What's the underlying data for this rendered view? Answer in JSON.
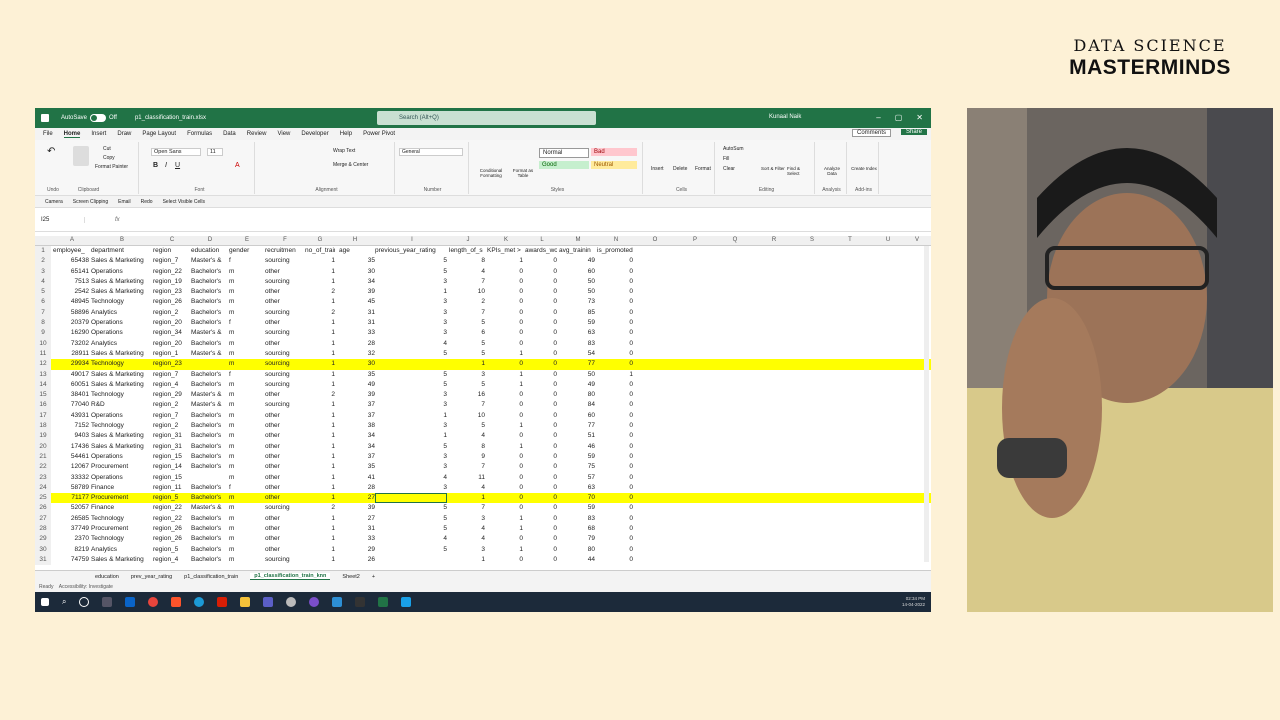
{
  "brand": {
    "line1": "DATA SCIENCE",
    "line2": "MASTERMINDS"
  },
  "titlebar": {
    "autosave_label": "AutoSave",
    "autosave_state": "Off",
    "file_name": "p1_classification_train.xlsx",
    "search_placeholder": "Search (Alt+Q)",
    "user": "Kunaal Naik"
  },
  "ribbon_tabs": [
    "File",
    "Home",
    "Insert",
    "Draw",
    "Page Layout",
    "Formulas",
    "Data",
    "Review",
    "View",
    "Developer",
    "Help",
    "Power Pivot"
  ],
  "comments_label": "Comments",
  "share_label": "Share",
  "ribbon": {
    "clipboard": {
      "cut": "Cut",
      "copy": "Copy",
      "format_painter": "Format Painter",
      "label": "Clipboard",
      "paste": "Paste",
      "undo": "Undo"
    },
    "font": {
      "name": "Open Sans",
      "size": "11",
      "label": "Font"
    },
    "alignment": {
      "wrap": "Wrap Text",
      "merge": "Merge & Center",
      "label": "Alignment"
    },
    "number": {
      "format": "General",
      "label": "Number"
    },
    "styles": {
      "conditional": "Conditional Formatting",
      "format_table": "Format as Table",
      "normal": "Normal",
      "bad": "Bad",
      "good": "Good",
      "neutral": "Neutral",
      "label": "Styles"
    },
    "cells": {
      "insert": "Insert",
      "delete": "Delete",
      "format": "Format",
      "label": "Cells"
    },
    "editing": {
      "autosum": "AutoSum",
      "fill": "Fill",
      "clear": "Clear",
      "sort": "Sort & Filter",
      "find": "Find & Select",
      "label": "Editing"
    },
    "analysis": {
      "analyze": "Analyze Data",
      "label": "Analysis"
    },
    "addins": {
      "create": "Create Index",
      "label": "Add-ins"
    }
  },
  "qat": [
    "Camera",
    "Screen Clipping",
    "Email",
    "Redo",
    "Select Visible Cells"
  ],
  "name_box": "I25",
  "columns": [
    "A",
    "B",
    "C",
    "D",
    "E",
    "F",
    "G",
    "H",
    "I",
    "J",
    "K",
    "L",
    "M",
    "N",
    "O",
    "P",
    "Q",
    "R",
    "S",
    "T",
    "U",
    "V"
  ],
  "header_row": {
    "rn": "1",
    "a": "employee_",
    "b": "department",
    "c": "region",
    "d": "education",
    "e": "gender",
    "f": "recruitmen",
    "g": "no_of_train",
    "h": "age",
    "i": "previous_year_rating",
    "j": "length_of_s",
    "k": "KPIs_met >",
    "l": "awards_wo",
    "m": "avg_trainin",
    "n": "is_promoted"
  },
  "rows": [
    {
      "rn": "2",
      "a": "65438",
      "b": "Sales & Marketing",
      "c": "region_7",
      "d": "Master's &",
      "e": "f",
      "f": "sourcing",
      "g": "1",
      "h": "35",
      "i": "5",
      "j": "8",
      "k": "1",
      "l": "0",
      "m": "49",
      "n": "0"
    },
    {
      "rn": "3",
      "a": "65141",
      "b": "Operations",
      "c": "region_22",
      "d": "Bachelor's",
      "e": "m",
      "f": "other",
      "g": "1",
      "h": "30",
      "i": "5",
      "j": "4",
      "k": "0",
      "l": "0",
      "m": "60",
      "n": "0"
    },
    {
      "rn": "4",
      "a": "7513",
      "b": "Sales & Marketing",
      "c": "region_19",
      "d": "Bachelor's",
      "e": "m",
      "f": "sourcing",
      "g": "1",
      "h": "34",
      "i": "3",
      "j": "7",
      "k": "0",
      "l": "0",
      "m": "50",
      "n": "0"
    },
    {
      "rn": "5",
      "a": "2542",
      "b": "Sales & Marketing",
      "c": "region_23",
      "d": "Bachelor's",
      "e": "m",
      "f": "other",
      "g": "2",
      "h": "39",
      "i": "1",
      "j": "10",
      "k": "0",
      "l": "0",
      "m": "50",
      "n": "0"
    },
    {
      "rn": "6",
      "a": "48945",
      "b": "Technology",
      "c": "region_26",
      "d": "Bachelor's",
      "e": "m",
      "f": "other",
      "g": "1",
      "h": "45",
      "i": "3",
      "j": "2",
      "k": "0",
      "l": "0",
      "m": "73",
      "n": "0"
    },
    {
      "rn": "7",
      "a": "58896",
      "b": "Analytics",
      "c": "region_2",
      "d": "Bachelor's",
      "e": "m",
      "f": "sourcing",
      "g": "2",
      "h": "31",
      "i": "3",
      "j": "7",
      "k": "0",
      "l": "0",
      "m": "85",
      "n": "0"
    },
    {
      "rn": "8",
      "a": "20379",
      "b": "Operations",
      "c": "region_20",
      "d": "Bachelor's",
      "e": "f",
      "f": "other",
      "g": "1",
      "h": "31",
      "i": "3",
      "j": "5",
      "k": "0",
      "l": "0",
      "m": "59",
      "n": "0"
    },
    {
      "rn": "9",
      "a": "16290",
      "b": "Operations",
      "c": "region_34",
      "d": "Master's &",
      "e": "m",
      "f": "sourcing",
      "g": "1",
      "h": "33",
      "i": "3",
      "j": "6",
      "k": "0",
      "l": "0",
      "m": "63",
      "n": "0"
    },
    {
      "rn": "10",
      "a": "73202",
      "b": "Analytics",
      "c": "region_20",
      "d": "Bachelor's",
      "e": "m",
      "f": "other",
      "g": "1",
      "h": "28",
      "i": "4",
      "j": "5",
      "k": "0",
      "l": "0",
      "m": "83",
      "n": "0"
    },
    {
      "rn": "11",
      "a": "28911",
      "b": "Sales & Marketing",
      "c": "region_1",
      "d": "Master's &",
      "e": "m",
      "f": "sourcing",
      "g": "1",
      "h": "32",
      "i": "5",
      "j": "5",
      "k": "1",
      "l": "0",
      "m": "54",
      "n": "0"
    },
    {
      "rn": "12",
      "a": "29934",
      "b": "Technology",
      "c": "region_23",
      "d": "",
      "e": "m",
      "f": "sourcing",
      "g": "1",
      "h": "30",
      "i": "",
      "j": "1",
      "k": "0",
      "l": "0",
      "m": "77",
      "n": "0",
      "hl": true
    },
    {
      "rn": "13",
      "a": "49017",
      "b": "Sales & Marketing",
      "c": "region_7",
      "d": "Bachelor's",
      "e": "f",
      "f": "sourcing",
      "g": "1",
      "h": "35",
      "i": "5",
      "j": "3",
      "k": "1",
      "l": "0",
      "m": "50",
      "n": "1"
    },
    {
      "rn": "14",
      "a": "60051",
      "b": "Sales & Marketing",
      "c": "region_4",
      "d": "Bachelor's",
      "e": "m",
      "f": "sourcing",
      "g": "1",
      "h": "49",
      "i": "5",
      "j": "5",
      "k": "1",
      "l": "0",
      "m": "49",
      "n": "0"
    },
    {
      "rn": "15",
      "a": "38401",
      "b": "Technology",
      "c": "region_29",
      "d": "Master's &",
      "e": "m",
      "f": "other",
      "g": "2",
      "h": "39",
      "i": "3",
      "j": "16",
      "k": "0",
      "l": "0",
      "m": "80",
      "n": "0"
    },
    {
      "rn": "16",
      "a": "77040",
      "b": "R&D",
      "c": "region_2",
      "d": "Master's &",
      "e": "m",
      "f": "sourcing",
      "g": "1",
      "h": "37",
      "i": "3",
      "j": "7",
      "k": "0",
      "l": "0",
      "m": "84",
      "n": "0"
    },
    {
      "rn": "17",
      "a": "43931",
      "b": "Operations",
      "c": "region_7",
      "d": "Bachelor's",
      "e": "m",
      "f": "other",
      "g": "1",
      "h": "37",
      "i": "1",
      "j": "10",
      "k": "0",
      "l": "0",
      "m": "60",
      "n": "0"
    },
    {
      "rn": "18",
      "a": "7152",
      "b": "Technology",
      "c": "region_2",
      "d": "Bachelor's",
      "e": "m",
      "f": "other",
      "g": "1",
      "h": "38",
      "i": "3",
      "j": "5",
      "k": "1",
      "l": "0",
      "m": "77",
      "n": "0"
    },
    {
      "rn": "19",
      "a": "9403",
      "b": "Sales & Marketing",
      "c": "region_31",
      "d": "Bachelor's",
      "e": "m",
      "f": "other",
      "g": "1",
      "h": "34",
      "i": "1",
      "j": "4",
      "k": "0",
      "l": "0",
      "m": "51",
      "n": "0"
    },
    {
      "rn": "20",
      "a": "17436",
      "b": "Sales & Marketing",
      "c": "region_31",
      "d": "Bachelor's",
      "e": "m",
      "f": "other",
      "g": "1",
      "h": "34",
      "i": "5",
      "j": "8",
      "k": "1",
      "l": "0",
      "m": "46",
      "n": "0"
    },
    {
      "rn": "21",
      "a": "54461",
      "b": "Operations",
      "c": "region_15",
      "d": "Bachelor's",
      "e": "m",
      "f": "other",
      "g": "1",
      "h": "37",
      "i": "3",
      "j": "9",
      "k": "0",
      "l": "0",
      "m": "59",
      "n": "0"
    },
    {
      "rn": "22",
      "a": "12067",
      "b": "Procurement",
      "c": "region_14",
      "d": "Bachelor's",
      "e": "m",
      "f": "other",
      "g": "1",
      "h": "35",
      "i": "3",
      "j": "7",
      "k": "0",
      "l": "0",
      "m": "75",
      "n": "0"
    },
    {
      "rn": "23",
      "a": "33332",
      "b": "Operations",
      "c": "region_15",
      "d": "",
      "e": "m",
      "f": "other",
      "g": "1",
      "h": "41",
      "i": "4",
      "j": "11",
      "k": "0",
      "l": "0",
      "m": "57",
      "n": "0"
    },
    {
      "rn": "24",
      "a": "58789",
      "b": "Finance",
      "c": "region_11",
      "d": "Bachelor's",
      "e": "f",
      "f": "other",
      "g": "1",
      "h": "28",
      "i": "3",
      "j": "4",
      "k": "0",
      "l": "0",
      "m": "63",
      "n": "0"
    },
    {
      "rn": "25",
      "a": "71177",
      "b": "Procurement",
      "c": "region_5",
      "d": "Bachelor's",
      "e": "m",
      "f": "other",
      "g": "1",
      "h": "27",
      "i": "",
      "j": "1",
      "k": "0",
      "l": "0",
      "m": "70",
      "n": "0",
      "hl": true
    },
    {
      "rn": "26",
      "a": "52057",
      "b": "Finance",
      "c": "region_22",
      "d": "Master's &",
      "e": "m",
      "f": "sourcing",
      "g": "2",
      "h": "39",
      "i": "5",
      "j": "7",
      "k": "0",
      "l": "0",
      "m": "59",
      "n": "0"
    },
    {
      "rn": "27",
      "a": "26585",
      "b": "Technology",
      "c": "region_22",
      "d": "Bachelor's",
      "e": "m",
      "f": "other",
      "g": "1",
      "h": "27",
      "i": "5",
      "j": "3",
      "k": "1",
      "l": "0",
      "m": "83",
      "n": "0"
    },
    {
      "rn": "28",
      "a": "37749",
      "b": "Procurement",
      "c": "region_26",
      "d": "Bachelor's",
      "e": "m",
      "f": "other",
      "g": "1",
      "h": "31",
      "i": "5",
      "j": "4",
      "k": "1",
      "l": "0",
      "m": "68",
      "n": "0"
    },
    {
      "rn": "29",
      "a": "2370",
      "b": "Technology",
      "c": "region_26",
      "d": "Bachelor's",
      "e": "m",
      "f": "other",
      "g": "1",
      "h": "33",
      "i": "4",
      "j": "4",
      "k": "0",
      "l": "0",
      "m": "79",
      "n": "0"
    },
    {
      "rn": "30",
      "a": "8219",
      "b": "Analytics",
      "c": "region_5",
      "d": "Bachelor's",
      "e": "m",
      "f": "other",
      "g": "1",
      "h": "29",
      "i": "5",
      "j": "3",
      "k": "1",
      "l": "0",
      "m": "80",
      "n": "0"
    },
    {
      "rn": "31",
      "a": "74759",
      "b": "Sales & Marketing",
      "c": "region_4",
      "d": "Bachelor's",
      "e": "m",
      "f": "sourcing",
      "g": "1",
      "h": "26",
      "i": "",
      "j": "1",
      "k": "0",
      "l": "0",
      "m": "44",
      "n": "0"
    }
  ],
  "sheet_tabs": [
    "education",
    "prev_year_rating",
    "p1_classification_train",
    "p1_classification_train_knn",
    "Sheet2"
  ],
  "active_sheet": "p1_classification_train_knn",
  "status": {
    "ready": "Ready",
    "accessibility": "Accessibility: Investigate"
  },
  "clock": {
    "time": "02:34 PM",
    "date": "14-04-2022"
  },
  "colors": {
    "excel_green": "#217346",
    "highlight": "#ffff00",
    "background": "#fdf1d6"
  }
}
